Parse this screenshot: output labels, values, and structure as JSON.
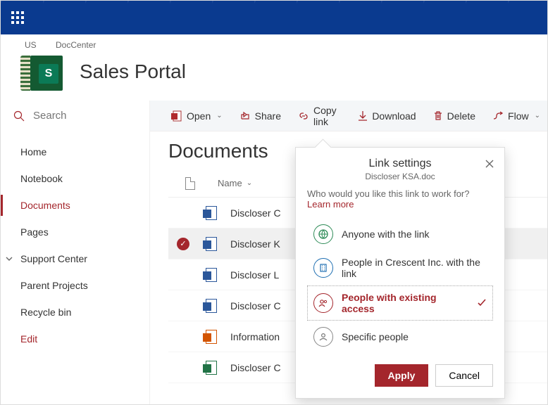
{
  "breadcrumbs": {
    "a": "US",
    "b": "DocCenter"
  },
  "site_title": "Sales Portal",
  "site_logo_letter": "S",
  "search": {
    "placeholder": "Search"
  },
  "quicklaunch": {
    "items": [
      {
        "label": "Home"
      },
      {
        "label": "Notebook"
      },
      {
        "label": "Documents",
        "active": true
      },
      {
        "label": "Pages"
      },
      {
        "label": "Support Center",
        "expandable": true
      },
      {
        "label": "Parent Projects"
      },
      {
        "label": "Recycle bin"
      }
    ],
    "edit_label": "Edit"
  },
  "commandbar": {
    "open": "Open",
    "share": "Share",
    "copylink": "Copy link",
    "download": "Download",
    "delete": "Delete",
    "flow": "Flow"
  },
  "library": {
    "title": "Documents",
    "columns": {
      "name": "Name"
    },
    "rows": [
      {
        "name": "Discloser C",
        "icon": "word"
      },
      {
        "name": "Discloser K",
        "icon": "word",
        "selected": true
      },
      {
        "name": "Discloser L",
        "icon": "word"
      },
      {
        "name": "Discloser C",
        "icon": "word"
      },
      {
        "name": "Information",
        "icon": "orange"
      },
      {
        "name": "Discloser C",
        "icon": "green"
      }
    ]
  },
  "callout": {
    "title": "Link settings",
    "subtitle": "Discloser KSA.doc",
    "question": "Who would you like this link to work for?",
    "learn_more": "Learn more",
    "options": {
      "anyone": "Anyone with the link",
      "org": "People in Crescent Inc. with the link",
      "existing": "People with existing access",
      "specific": "Specific people"
    },
    "apply": "Apply",
    "cancel": "Cancel"
  }
}
